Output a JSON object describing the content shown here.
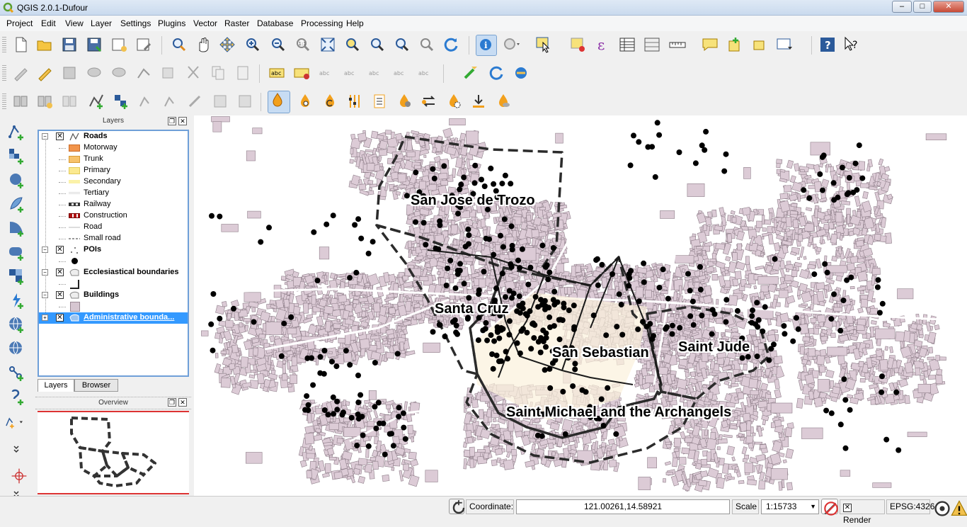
{
  "window": {
    "title": "QGIS 2.0.1-Dufour",
    "minimize": "–",
    "maximize": "□",
    "close": "✕"
  },
  "menu": [
    "Project",
    "Edit",
    "View",
    "Layer",
    "Settings",
    "Plugins",
    "Vector",
    "Raster",
    "Database",
    "Processing",
    "Help"
  ],
  "layers_panel": {
    "title": "Layers",
    "tabs": [
      "Layers",
      "Browser"
    ],
    "layers": [
      {
        "name": "Roads",
        "expanded": true,
        "checked": true,
        "legend": [
          "Motorway",
          "Trunk",
          "Primary",
          "Secondary",
          "Tertiary",
          "Railway",
          "Construction",
          "Road",
          "Small road"
        ]
      },
      {
        "name": "POIs",
        "expanded": true,
        "checked": true
      },
      {
        "name": "Ecclesiastical boundaries",
        "expanded": true,
        "checked": true
      },
      {
        "name": "Buildings",
        "expanded": true,
        "checked": true
      },
      {
        "name": "Administrative bounda...",
        "expanded": false,
        "checked": true,
        "selected": true
      }
    ]
  },
  "overview_panel": {
    "title": "Overview"
  },
  "map": {
    "labels": [
      "San Jose de Trozo",
      "Santa Cruz",
      "San Sebastian",
      "Saint Jude",
      "Saint Michael and the Archangels"
    ]
  },
  "statusbar": {
    "coordinate_label": "Coordinate:",
    "coordinate_value": "121.00261,14.58921",
    "scale_label": "Scale",
    "scale_value": "1:15733",
    "render_label": "Render",
    "crs": "EPSG:4326"
  }
}
